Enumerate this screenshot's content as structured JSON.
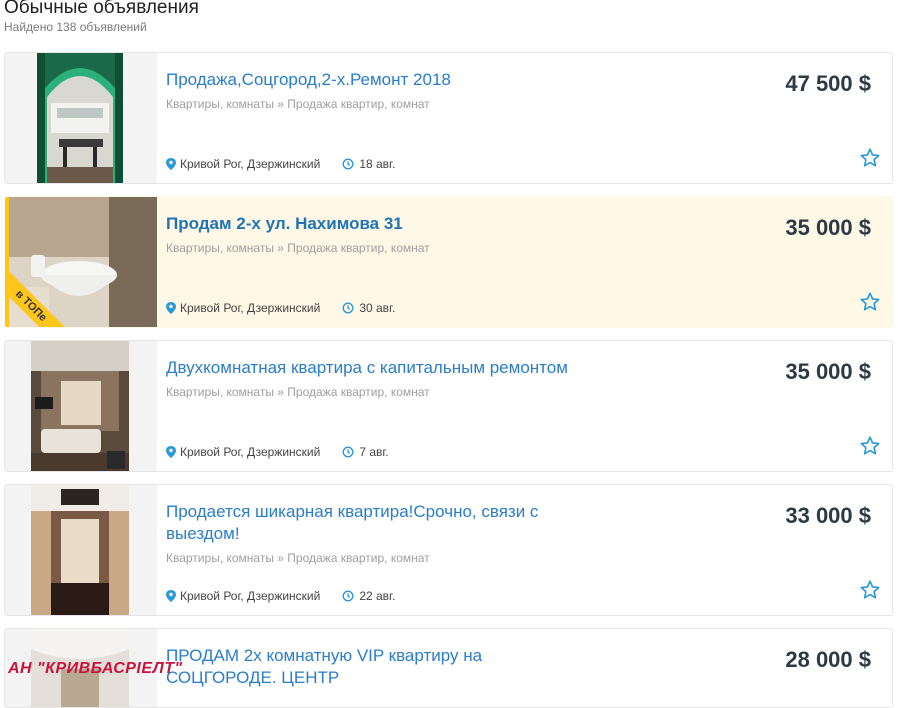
{
  "page": {
    "heading": "Обычные объявления",
    "found": "Найдено 138 объявлений",
    "watermark": "АН \"КРИВБАСРІЕЛТ\""
  },
  "listings": [
    {
      "title_l1": "Продажа,Соцгород,2-х.Ремонт 2018",
      "title_l2": "",
      "category": "Квартиры, комнаты » Продажа квартир, комнат",
      "location": "Кривой Рог, Дзержинский",
      "date": "18 авг.",
      "price": "47 500 $",
      "promoted": false
    },
    {
      "title_l1": "Продам 2-х ул. Нахимова 31",
      "title_l2": "",
      "category": "Квартиры, комнаты » Продажа квартир, комнат",
      "location": "Кривой Рог, Дзержинский",
      "date": "30 авг.",
      "price": "35 000 $",
      "promoted": true,
      "badge": "в ТОПе"
    },
    {
      "title_l1": "Двухкомнатная квартира с капитальным ремонтом",
      "title_l2": "",
      "category": "Квартиры, комнаты » Продажа квартир, комнат",
      "location": "Кривой Рог, Дзержинский",
      "date": "7 авг.",
      "price": "35 000 $",
      "promoted": false
    },
    {
      "title_l1": "Продается шикарная квартира!Срочно, связи с",
      "title_l2": "выездом!",
      "category": "Квартиры, комнаты » Продажа квартир, комнат",
      "location": "Кривой Рог, Дзержинский",
      "date": "22 авг.",
      "price": "33 000 $",
      "promoted": false
    },
    {
      "title_l1": "ПРОДАМ 2х комнатную VIP квартиру на",
      "title_l2": "СОЦГОРОДЕ. ЦЕНТР",
      "price": "28 000 $",
      "promoted": false
    }
  ],
  "colors": {
    "link": "#2a7dc9",
    "promoted_bg": "#fff8e6",
    "promoted_accent": "#ffc61a",
    "price": "#2b3a44",
    "star": "#2a9ad6",
    "watermark": "#c8143c"
  },
  "icons": {
    "location": "map-pin-icon",
    "date": "clock-history-icon",
    "favorite": "star-outline-icon"
  }
}
